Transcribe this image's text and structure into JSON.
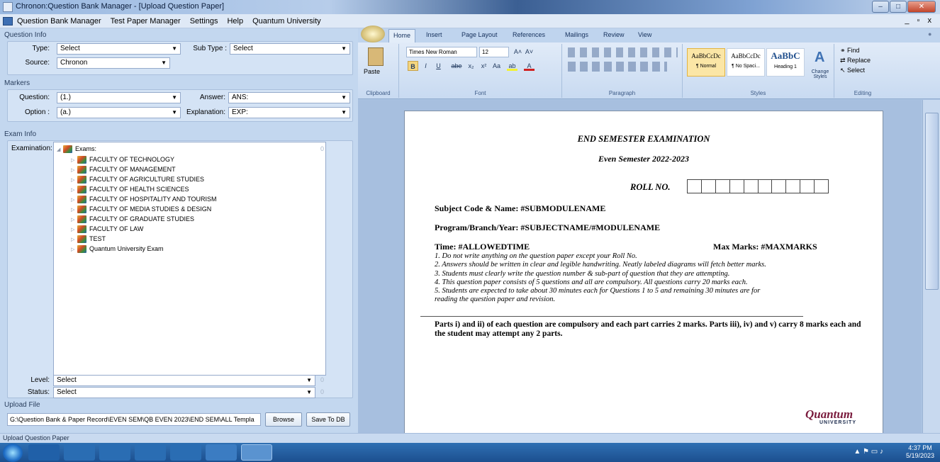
{
  "window": {
    "title": "Chronon:Question Bank Manager - [Upload Question Paper]",
    "controls": [
      "–",
      "□",
      "✕"
    ],
    "mdi_controls": "_ ▫ x"
  },
  "menu": [
    "Question Bank Manager",
    "Test Paper Manager",
    "Settings",
    "Help",
    "Quantum University"
  ],
  "question_info": {
    "header": "Question Info",
    "type_label": "Type:",
    "type_value": "Select",
    "subtype_label": "Sub Type :",
    "subtype_value": "Select",
    "source_label": "Source:",
    "source_value": "Chronon"
  },
  "markers": {
    "header": "Markers",
    "question_label": "Question:",
    "question_value": "(1.)",
    "answer_label": "Answer:",
    "answer_value": "ANS:",
    "option_label": "Option :",
    "option_value": "(a.)",
    "explanation_label": "Explanation:",
    "explanation_value": "EXP:"
  },
  "exam_info": {
    "header": "Exam Info",
    "examination_label": "Examination:",
    "root": "Exams:",
    "items": [
      "FACULTY OF TECHNOLOGY",
      "FACULTY OF MANAGEMENT",
      "FACULTY OF AGRICULTURE STUDIES",
      "FACULTY OF HEALTH SCIENCES",
      "FACULTY OF HOSPITALITY AND TOURISM",
      "FACULTY OF MEDIA STUDIES & DESIGN",
      "FACULTY OF GRADUATE STUDIES",
      "FACULTY OF LAW",
      "TEST",
      "Quantum University Exam"
    ],
    "zero_hint": "0",
    "level_label": "Level:",
    "level_value": "Select",
    "status_label": "Status:",
    "status_value": "Select"
  },
  "upload": {
    "header": "Upload File",
    "path": "G:\\Question Bank & Paper Record\\EVEN SEM\\QB EVEN 2023\\END SEM\\ALL Templa",
    "browse": "Browse",
    "save": "Save To DB"
  },
  "statusbar": "Upload Question Paper",
  "word": {
    "tabs": [
      "Home",
      "Insert",
      "Page Layout",
      "References",
      "Mailings",
      "Review",
      "View"
    ],
    "clipboard": {
      "paste": "Paste",
      "label": "Clipboard"
    },
    "font": {
      "name": "Times New Roman",
      "size": "12",
      "label": "Font",
      "grow": "A˄",
      "shrink": "A˅",
      "bold": "B",
      "italic": "I",
      "underline": "U",
      "strike": "abe",
      "sub": "x₂",
      "sup": "x²",
      "case": "Aa",
      "highlight": "ab",
      "color": "A"
    },
    "paragraph_label": "Paragraph",
    "styles": [
      {
        "sample": "AaBbCcDc",
        "name": "¶ Normal"
      },
      {
        "sample": "AaBbCcDc",
        "name": "¶ No Spaci..."
      },
      {
        "sample": "AaBbC",
        "name": "Heading 1"
      }
    ],
    "change_styles": "Change Styles",
    "styles_label": "Styles",
    "editing": {
      "find": "Find",
      "replace": "Replace",
      "select": "Select",
      "label": "Editing"
    }
  },
  "document": {
    "heading": "END SEMESTER EXAMINATION",
    "semester": "Even Semester 2022-2023",
    "roll": "ROLL NO.",
    "subject": "Subject Code & Name: #SUBMODULENAME",
    "program": "Program/Branch/Year: #SUBJECTNAME/#MODULENAME",
    "time": "Time: #ALLOWEDTIME",
    "max_marks": "Max Marks: #MAXMARKS",
    "instructions": [
      "1. Do not write anything on the question paper except your Roll No.",
      "2. Answers should be written in clear and legible handwriting. Neatly labeled diagrams will fetch better marks.",
      "3. Students must clearly write the question number & sub-part of question that they are attempting.",
      "4. This question paper consists of 5 questions and all are compulsory. All questions carry 20 marks each.",
      "5. Students are expected to take about 30 minutes each for Questions 1 to 5 and remaining 30 minutes are for",
      "reading the question paper and revision."
    ],
    "parts": "Parts i) and ii) of each question are compulsory and each part carries 2 marks. Parts iii), iv) and v) carry 8 marks each and the student may attempt any 2 parts.",
    "logo": "Quantum",
    "logo_sub": "UNIVERSITY"
  },
  "tray": {
    "time": "4:37 PM",
    "date": "5/19/2023"
  }
}
